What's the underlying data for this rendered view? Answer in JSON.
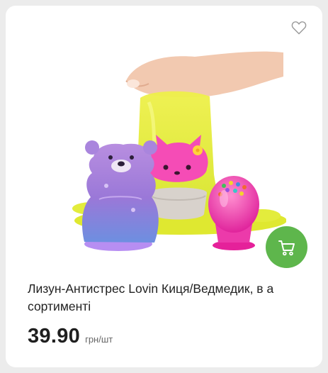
{
  "product": {
    "title": "Лизун-Антистрес Lovin Киця/Ведмедик, в а сортименті",
    "price": "39.90",
    "unit": "грн/шт"
  },
  "icons": {
    "favorite": "heart-outline-icon",
    "cart": "shopping-cart-icon"
  },
  "colors": {
    "cart_button": "#5eb64c",
    "background": "#ececec",
    "card": "#ffffff"
  }
}
